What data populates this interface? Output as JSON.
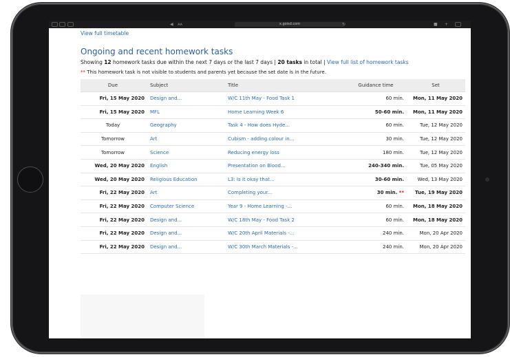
{
  "browser": {
    "url": "x.goisd.com"
  },
  "page": {
    "timetable_link": "View full timetable",
    "heading": "Ongoing and recent homework tasks",
    "showing_prefix": "Showing ",
    "showing_count": "12",
    "showing_mid": " homework tasks due within the next 7 days or the last 7 days | ",
    "showing_total": "20 tasks",
    "showing_in_total": " in total | ",
    "view_full_list": "View full list of homework tasks",
    "note_stars": "**",
    "note_text": " This homework task is not visible to students and parents yet because the set date is in the future."
  },
  "table": {
    "headers": {
      "due": "Due",
      "subject": "Subject",
      "title": "Title",
      "guidance": "Guidance time",
      "set": "Set"
    },
    "rows": [
      {
        "due": "Fri, 15 May 2020",
        "subject": "Design and...",
        "title": "W/C 11th May - Food Task 1",
        "guidance": "60 min.",
        "set": "Mon, 11 May 2020",
        "star": ""
      },
      {
        "due": "Fri, 15 May 2020",
        "subject": "MFL",
        "title": "Home Learning Week 6",
        "guidance": "50-60 min.",
        "set": "Mon, 11 May 2020",
        "star": ""
      },
      {
        "due": "Today",
        "subject": "Geography",
        "title": "Task 4 - How does Hyde...",
        "guidance": "60 min.",
        "set": "Tue, 12 May 2020",
        "star": ""
      },
      {
        "due": "Tomorrow",
        "subject": "Art",
        "title": "Cubism - adding colour in...",
        "guidance": "30 min.",
        "set": "Tue, 12 May 2020",
        "star": ""
      },
      {
        "due": "Tomorrow",
        "subject": "Science",
        "title": "Reducing energy loss",
        "guidance": "180 min.",
        "set": "Tue, 12 May 2020",
        "star": ""
      },
      {
        "due": "Wed, 20 May 2020",
        "subject": "English",
        "title": "Presentation on Blood...",
        "guidance": "240-340 min.",
        "set": "Tue, 05 May 2020",
        "star": ""
      },
      {
        "due": "Wed, 20 May 2020",
        "subject": "Religious Education",
        "title": "L3: Is it okay that...",
        "guidance": "30-60 min.",
        "set": "Wed, 13 May 2020",
        "star": ""
      },
      {
        "due": "Fri, 22 May 2020",
        "subject": "Art",
        "title": "Completing your...",
        "guidance": "30 min.",
        "set": "Tue, 19 May 2020",
        "star": "**"
      },
      {
        "due": "Fri, 22 May 2020",
        "subject": "Computer Science",
        "title": "Year 9 - Home Learning -...",
        "guidance": "60 min.",
        "set": "Mon, 18 May 2020",
        "star": ""
      },
      {
        "due": "Fri, 22 May 2020",
        "subject": "Design and...",
        "title": "W/C 18th May - Food Task 2",
        "guidance": "60 min.",
        "set": "Mon, 18 May 2020",
        "star": ""
      },
      {
        "due": "Fri, 22 May 2020",
        "subject": "Design and...",
        "title": "W/C 20th April Materials -...",
        "guidance": "240 min.",
        "set": "Mon, 20 Apr 2020",
        "star": ""
      },
      {
        "due": "Fri, 22 May 2020",
        "subject": "Design and...",
        "title": "W/C 30th March Materials -...",
        "guidance": "240 min.",
        "set": "Mon, 20 Apr 2020",
        "star": ""
      }
    ]
  }
}
